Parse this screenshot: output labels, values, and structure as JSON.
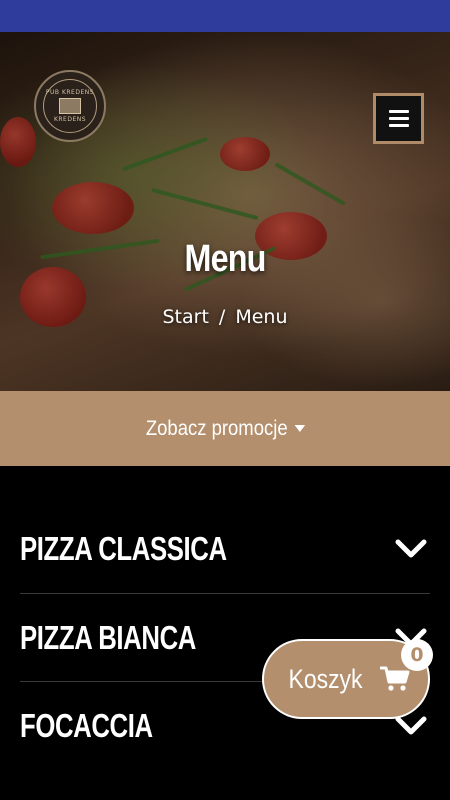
{
  "hero": {
    "title": "Menu",
    "breadcrumb": {
      "home": "Start",
      "separator": "/",
      "current": "Menu"
    }
  },
  "logo": {
    "top_text": "PUB KREDENS",
    "bottom_text": "KREDENS"
  },
  "promo": {
    "label": "Zobacz promocje",
    "icon": "caret-down-icon"
  },
  "categories": [
    {
      "label": "PIZZA CLASSICA",
      "icon": "chevron-down-icon"
    },
    {
      "label": "PIZZA BIANCA",
      "icon": "chevron-down-icon"
    },
    {
      "label": "FOCACCIA",
      "icon": "chevron-down-icon"
    }
  ],
  "cart": {
    "label": "Koszyk",
    "count": "0",
    "icon": "shopping-cart-icon"
  },
  "colors": {
    "accent": "#b38f6d",
    "statusbar": "#2f3c9c",
    "background": "#000000"
  }
}
